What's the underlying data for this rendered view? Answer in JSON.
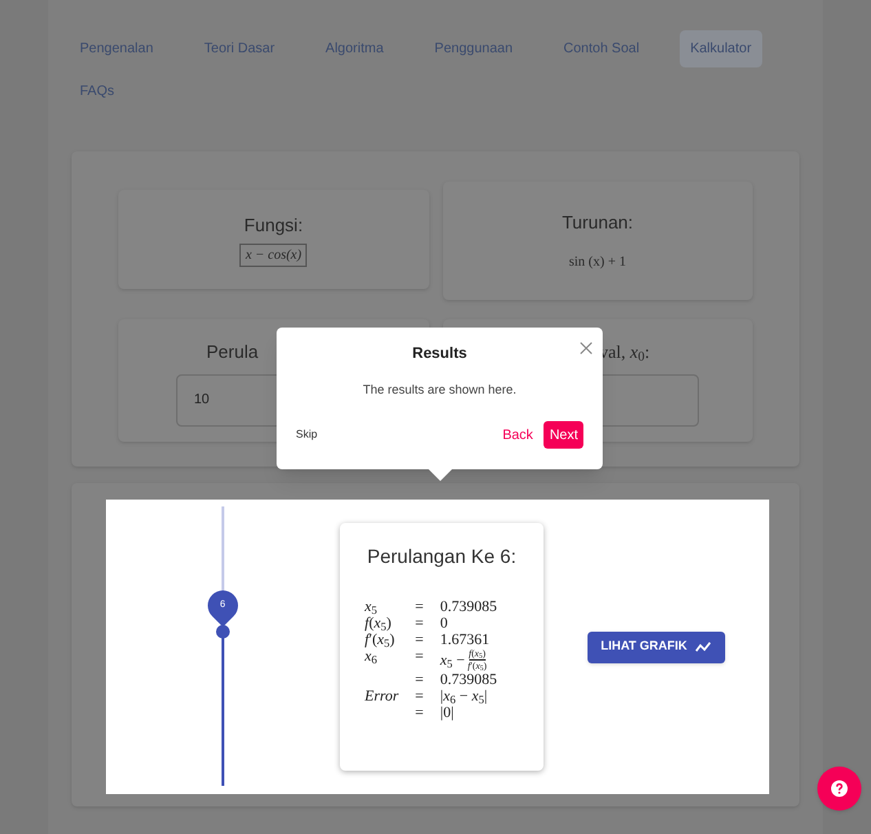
{
  "nav": [
    {
      "label": "Pengenalan",
      "selected": false
    },
    {
      "label": "Teori Dasar",
      "selected": false
    },
    {
      "label": "Algoritma",
      "selected": false
    },
    {
      "label": "Penggunaan",
      "selected": false
    },
    {
      "label": "Contoh Soal",
      "selected": false
    },
    {
      "label": "Kalkulator",
      "selected": true
    },
    {
      "label": "FAQs",
      "selected": false
    }
  ],
  "function_card": {
    "label": "Fungsi:",
    "value": "x − cos(x)"
  },
  "derivative_card": {
    "label": "Turunan:",
    "value": "sin (x) + 1"
  },
  "iterations_card": {
    "label": "Perula",
    "value": "10"
  },
  "initial_card": {
    "label": "val, *x*$_{0}$:"
  },
  "tour": {
    "title": "Results",
    "body": "The results are shown here.",
    "skip": "Skip",
    "back": "Back",
    "next": "Next"
  },
  "results": {
    "slider": {
      "value_label": "6",
      "level": 0.55
    },
    "title": "Perulangan Ke 6:",
    "rows": [
      {
        "lhs": "*x*$_{5}$",
        "rhs": "0.739085"
      },
      {
        "lhs": "*f*(*x*$_{5}$)",
        "rhs": "0"
      },
      {
        "lhs": "*f*′(*x*$_{5}$)",
        "rhs": "1.67361"
      },
      {
        "lhs": "*x*$_{6}$",
        "rhs": "*x*$_{5}$ −",
        "numerator": "*f*(*x*$_{5}$)",
        "denominator": "*f*′(*x*$_{5}$)"
      },
      {
        "rhs": "0.739085"
      },
      {
        "lhs": "*Error*",
        "rhs": "|*x*$_{6}$ − *x*$_{5}$|"
      },
      {
        "rhs": "|0|"
      }
    ],
    "eq": "=",
    "chart_button": "LIHAT GRAFIK"
  }
}
